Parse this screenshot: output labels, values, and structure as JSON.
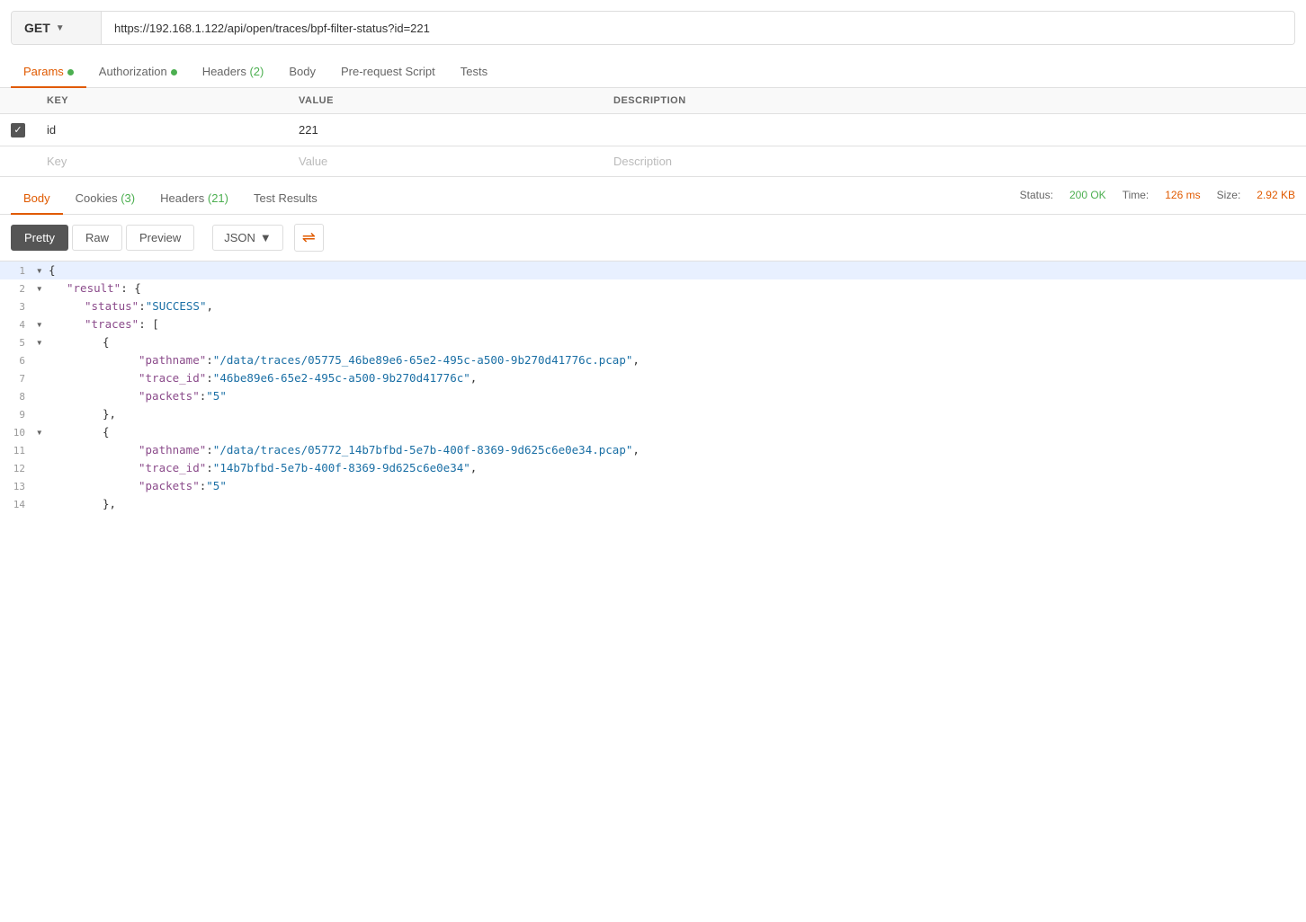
{
  "method": {
    "value": "GET",
    "chevron": "▼"
  },
  "url": {
    "value": "https://192.168.1.122/api/open/traces/bpf-filter-status?id=221"
  },
  "request_tabs": [
    {
      "id": "params",
      "label": "Params",
      "dot": true,
      "active": true
    },
    {
      "id": "authorization",
      "label": "Authorization",
      "dot": true
    },
    {
      "id": "headers",
      "label": "Headers",
      "count": "(2)"
    },
    {
      "id": "body",
      "label": "Body"
    },
    {
      "id": "prerequest",
      "label": "Pre-request Script"
    },
    {
      "id": "tests",
      "label": "Tests"
    }
  ],
  "params_columns": [
    "KEY",
    "VALUE",
    "DESCRIPTION"
  ],
  "params_rows": [
    {
      "checked": true,
      "key": "id",
      "value": "221",
      "description": ""
    }
  ],
  "params_placeholder": {
    "key": "Key",
    "value": "Value",
    "description": "Description"
  },
  "response_tabs": [
    {
      "id": "body",
      "label": "Body",
      "active": true
    },
    {
      "id": "cookies",
      "label": "Cookies",
      "count": "(3)"
    },
    {
      "id": "headers",
      "label": "Headers",
      "count": "(21)"
    },
    {
      "id": "test_results",
      "label": "Test Results"
    }
  ],
  "response_status": {
    "label_status": "Status:",
    "status": "200 OK",
    "label_time": "Time:",
    "time": "126 ms",
    "label_size": "Size:",
    "size": "2.92 KB"
  },
  "format_buttons": [
    "Pretty",
    "Raw",
    "Preview"
  ],
  "format_active": "Pretty",
  "format_type": "JSON",
  "json_lines": [
    {
      "num": 1,
      "arrow": "▾",
      "indent": 0,
      "content": "{",
      "highlight": true
    },
    {
      "num": 2,
      "arrow": "▾",
      "indent": 1,
      "key": "\"result\"",
      "punct_after": ": {",
      "highlight": false
    },
    {
      "num": 3,
      "arrow": null,
      "indent": 2,
      "key": "\"status\"",
      "punct": ": ",
      "value": "\"SUCCESS\"",
      "punct_end": ",",
      "highlight": false
    },
    {
      "num": 4,
      "arrow": "▾",
      "indent": 2,
      "key": "\"traces\"",
      "punct_after": ": [",
      "highlight": false
    },
    {
      "num": 5,
      "arrow": "▾",
      "indent": 3,
      "content": "{",
      "highlight": false
    },
    {
      "num": 6,
      "arrow": null,
      "indent": 4,
      "key": "\"pathname\"",
      "punct": ": ",
      "value": "\"/data/traces/05775_46be89e6-65e2-495c-a500-9b270d41776c.pcap\"",
      "punct_end": ",",
      "highlight": false
    },
    {
      "num": 7,
      "arrow": null,
      "indent": 4,
      "key": "\"trace_id\"",
      "punct": ": ",
      "value": "\"46be89e6-65e2-495c-a500-9b270d41776c\"",
      "punct_end": ",",
      "highlight": false
    },
    {
      "num": 8,
      "arrow": null,
      "indent": 4,
      "key": "\"packets\"",
      "punct": ": ",
      "value": "\"5\"",
      "punct_end": "",
      "highlight": false
    },
    {
      "num": 9,
      "arrow": null,
      "indent": 3,
      "content": "},",
      "highlight": false
    },
    {
      "num": 10,
      "arrow": "▾",
      "indent": 3,
      "content": "{",
      "highlight": false
    },
    {
      "num": 11,
      "arrow": null,
      "indent": 4,
      "key": "\"pathname\"",
      "punct": ": ",
      "value": "\"/data/traces/05772_14b7bfbd-5e7b-400f-8369-9d625c6e0e34.pcap\"",
      "punct_end": ",",
      "highlight": false
    },
    {
      "num": 12,
      "arrow": null,
      "indent": 4,
      "key": "\"trace_id\"",
      "punct": ": ",
      "value": "\"14b7bfbd-5e7b-400f-8369-9d625c6e0e34\"",
      "punct_end": ",",
      "highlight": false
    },
    {
      "num": 13,
      "arrow": null,
      "indent": 4,
      "key": "\"packets\"",
      "punct": ": ",
      "value": "\"5\"",
      "punct_end": "",
      "highlight": false
    },
    {
      "num": 14,
      "arrow": null,
      "indent": 3,
      "content": "},",
      "highlight": false
    }
  ]
}
